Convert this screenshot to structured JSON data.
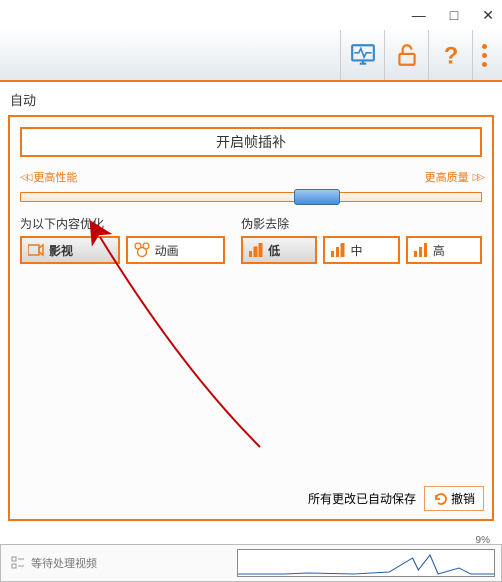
{
  "titlebar": {
    "minimize": "—",
    "maximize": "□",
    "close": "✕"
  },
  "auto_label": "自动",
  "main_button": "开启帧插补",
  "perf": {
    "left": "更高性能",
    "right": "更高质量"
  },
  "optimize": {
    "label": "为以下内容优化",
    "opt1": "影视",
    "opt2": "动画"
  },
  "artifact": {
    "label": "伪影去除",
    "low": "低",
    "mid": "中",
    "high": "高"
  },
  "status": {
    "saved": "所有更改已自动保存",
    "undo": "撤销"
  },
  "bottom": {
    "waiting": "等待处理视频",
    "percent": "9%"
  }
}
